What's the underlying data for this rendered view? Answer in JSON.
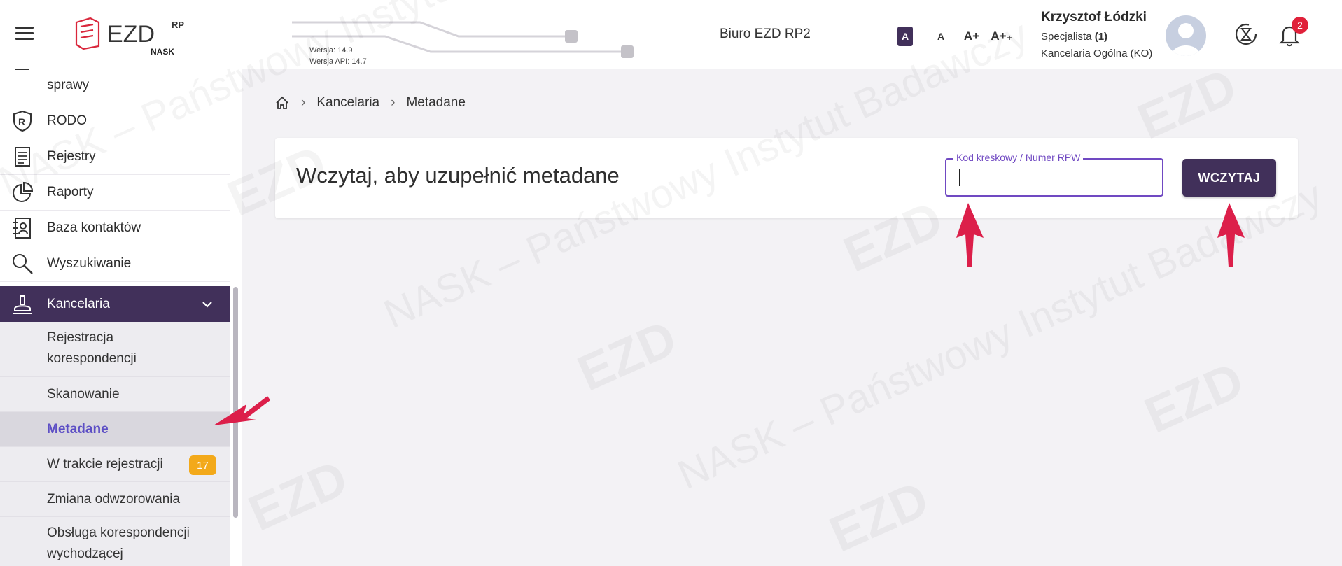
{
  "header": {
    "menu_icon": "hamburger-menu-icon",
    "logo_text": "EZD",
    "logo_sup": "RP",
    "logo_sub": "NASK",
    "version": "Wersja: 14.9",
    "api_version": "Wersja API: 14.7",
    "office": "Biuro EZD RP2",
    "font_sizes": [
      "A",
      "A",
      "A+",
      "A++"
    ],
    "font_size_labels": [
      "A",
      "A",
      "A+",
      "A+₊"
    ],
    "user": {
      "name": "Krzysztof Łódzki",
      "role_label": "Specjalista",
      "role_count": "(1)",
      "department": "Kancelaria Ogólna (KO)"
    },
    "notifications_count": "2",
    "accent": "#41305a",
    "badge_color": "#e0213a"
  },
  "sidebar": {
    "partial_item": "sprawy",
    "items": [
      {
        "label": "RODO",
        "icon": "shield-r-icon"
      },
      {
        "label": "Rejestry",
        "icon": "document-list-icon"
      },
      {
        "label": "Raporty",
        "icon": "pie-chart-icon"
      },
      {
        "label": "Baza kontaktów",
        "icon": "contact-book-icon"
      },
      {
        "label": "Wyszukiwanie",
        "icon": "search-icon"
      },
      {
        "label": "Kancelaria",
        "icon": "stamp-icon",
        "active": true,
        "expanded": true
      }
    ],
    "subitems": [
      {
        "label_line1": "Rejestracja",
        "label_line2": "korespondencji"
      },
      {
        "label": "Skanowanie"
      },
      {
        "label": "Metadane",
        "active": true
      },
      {
        "label": "W trakcie rejestracji",
        "badge": "17"
      },
      {
        "label": "Zmiana odwzorowania"
      },
      {
        "label_line1": "Obsługa korespondencji",
        "label_line2": "wychodzącej"
      }
    ],
    "badge_color": "#f3a91a",
    "active_sub_color": "#5d4fc5"
  },
  "breadcrumb": {
    "home_icon": "home-icon",
    "items": [
      "Kancelaria",
      "Metadane"
    ],
    "separator": "›"
  },
  "main": {
    "title": "Wczytaj, aby uzupełnić metadane",
    "field_label": "Kod kreskowy / Numer RPW",
    "field_value": "",
    "submit_label": "WCZYTAJ",
    "field_border_color": "#7049c2"
  },
  "watermark_text": "NASK – Państwowy Instytut Badawczy",
  "annotation_arrow_color": "#dc1f4a"
}
